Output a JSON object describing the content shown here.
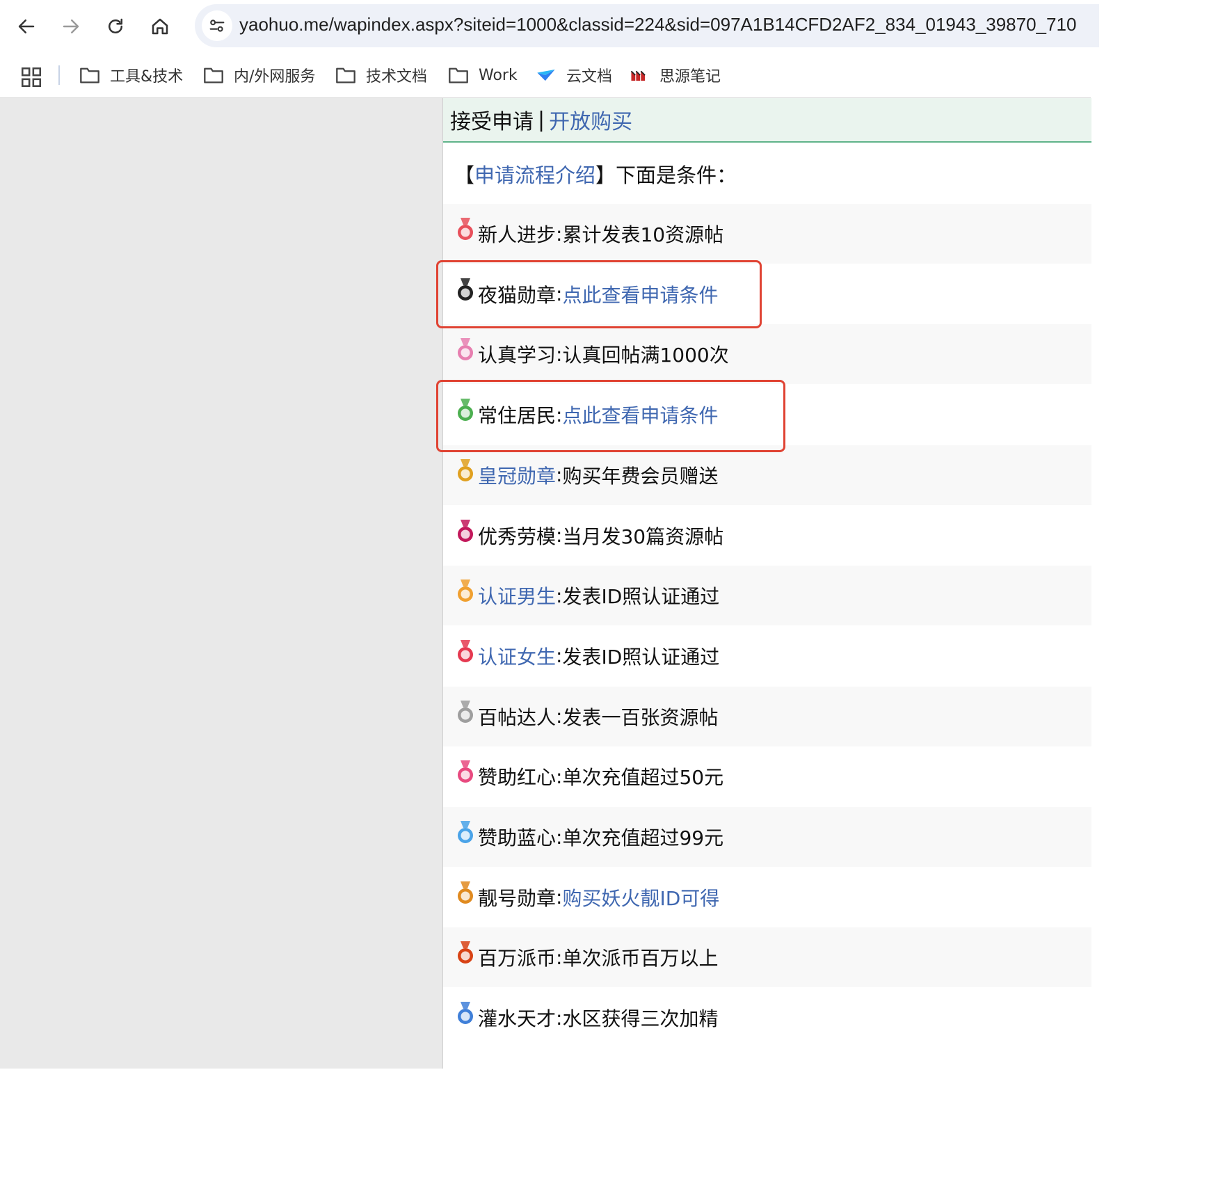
{
  "browser": {
    "url": "yaohuo.me/wapindex.aspx?siteid=1000&classid=224&sid=097A1B14CFD2AF2_834_01943_39870_710",
    "bookmarks": [
      {
        "label": "工具&技术",
        "icon": "folder-icon"
      },
      {
        "label": "内/外网服务",
        "icon": "folder-icon"
      },
      {
        "label": "技术文档",
        "icon": "folder-icon"
      },
      {
        "label": "Work",
        "icon": "folder-icon"
      },
      {
        "label": "云文档",
        "icon": "cloud-doc-icon"
      },
      {
        "label": "思源笔记",
        "icon": "siyuan-icon"
      }
    ]
  },
  "page": {
    "header": {
      "accept": "接受申请",
      "separator": "|",
      "open_buy": "开放购买"
    },
    "intro": {
      "bracket_open": "【",
      "link": "申请流程介绍",
      "bracket_close": "】",
      "text": "下面是条件："
    },
    "medals": [
      {
        "name": "新人进步",
        "name_link": false,
        "sep": ":",
        "desc": "累计发表10资源帖",
        "desc_link": false,
        "icon": "new-medal-icon",
        "color": "#e8505b"
      },
      {
        "name": "夜猫勋章",
        "name_link": false,
        "sep": ":",
        "desc": "点此查看申请条件",
        "desc_link": true,
        "icon": "night-cat-medal-icon",
        "color": "#222222",
        "highlighted": true
      },
      {
        "name": "认真学习",
        "name_link": false,
        "sep": ":",
        "desc": "认真回帖满1000次",
        "desc_link": false,
        "icon": "study-medal-icon",
        "color": "#e77fb0"
      },
      {
        "name": "常住居民",
        "name_link": false,
        "sep": ":",
        "desc": "点此查看申请条件",
        "desc_link": true,
        "icon": "resident-medal-icon",
        "color": "#4caf50",
        "highlighted": true
      },
      {
        "name": "皇冠勋章",
        "name_link": true,
        "sep": ":",
        "desc": "购买年费会员赠送",
        "desc_link": false,
        "icon": "crown-medal-icon",
        "color": "#e0a020"
      },
      {
        "name": "优秀劳模",
        "name_link": false,
        "sep": ":",
        "desc": "当月发30篇资源帖",
        "desc_link": false,
        "icon": "model-worker-medal-icon",
        "color": "#c2185b"
      },
      {
        "name": "认证男生",
        "name_link": true,
        "sep": ":",
        "desc": "发表ID照认证通过",
        "desc_link": false,
        "icon": "male-medal-icon",
        "color": "#f0a030"
      },
      {
        "name": "认证女生",
        "name_link": true,
        "sep": ":",
        "desc": "发表ID照认证通过",
        "desc_link": false,
        "icon": "female-medal-icon",
        "color": "#e53950"
      },
      {
        "name": "百帖达人",
        "name_link": false,
        "sep": ":",
        "desc": "发表一百张资源帖",
        "desc_link": false,
        "icon": "hundred-posts-medal-icon",
        "color": "#9e9e9e"
      },
      {
        "name": "赞助红心",
        "name_link": false,
        "sep": ":",
        "desc": "单次充值超过50元",
        "desc_link": false,
        "icon": "red-heart-medal-icon",
        "color": "#e84a7f"
      },
      {
        "name": "赞助蓝心",
        "name_link": false,
        "sep": ":",
        "desc": "单次充值超过99元",
        "desc_link": false,
        "icon": "blue-heart-medal-icon",
        "color": "#4aa3e8"
      },
      {
        "name": "靓号勋章",
        "name_link": false,
        "sep": ":",
        "desc": "购买妖火靓ID可得",
        "desc_link": true,
        "icon": "pretty-id-medal-icon",
        "color": "#e08a20"
      },
      {
        "name": "百万派币",
        "name_link": false,
        "sep": ":",
        "desc": "单次派币百万以上",
        "desc_link": false,
        "icon": "million-coin-medal-icon",
        "color": "#d84315"
      },
      {
        "name": "灌水天才",
        "name_link": false,
        "sep": ":",
        "desc": "水区获得三次加精",
        "desc_link": false,
        "icon": "water-genius-medal-icon",
        "color": "#3f7fd8"
      }
    ]
  }
}
